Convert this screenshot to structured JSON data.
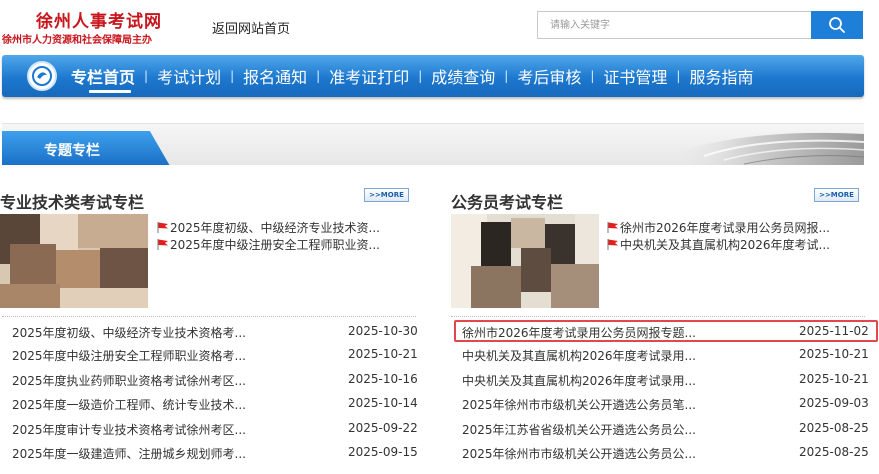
{
  "header": {
    "site_title": "徐州人事考试网",
    "site_subtitle": "徐州市人力资源和社会保障局主办",
    "home_link": "返回网站首页",
    "search_placeholder": "请输入关键字"
  },
  "nav": {
    "items": [
      "专栏首页",
      "考试计划",
      "报名通知",
      "准考证打印",
      "成绩查询",
      "考后审核",
      "证书管理",
      "服务指南"
    ],
    "active_index": 0
  },
  "banner": {
    "label": "专题专栏"
  },
  "colors": {
    "accent_blue": "#1e7fd8",
    "brand_red": "#c8161d",
    "flag_red": "#e02020",
    "highlight_red": "#e0484e"
  },
  "left": {
    "title": "专业技术类考试专栏",
    "more": ">>MORE",
    "featured": [
      "2025年度初级、中级经济专业技术资...",
      "2025年度中级注册安全工程师职业资..."
    ],
    "list": [
      {
        "title": "2025年度初级、中级经济专业技术资格考...",
        "date": "2025-10-30"
      },
      {
        "title": "2025年度中级注册安全工程师职业资格考...",
        "date": "2025-10-21"
      },
      {
        "title": "2025年度执业药师职业资格考试徐州考区...",
        "date": "2025-10-16"
      },
      {
        "title": "2025年度一级造价工程师、统计专业技术...",
        "date": "2025-10-14"
      },
      {
        "title": "2025年度审计专业技术资格考试徐州考区...",
        "date": "2025-09-22"
      },
      {
        "title": "2025年度一级建造师、注册城乡规划师考...",
        "date": "2025-09-15"
      }
    ]
  },
  "right": {
    "title": "公务员考试专栏",
    "more": ">>MORE",
    "featured": [
      "徐州市2026年度考试录用公务员网报...",
      "中央机关及其直属机构2026年度考试..."
    ],
    "list": [
      {
        "title": "徐州市2026年度考试录用公务员网报专题...",
        "date": "2025-11-02"
      },
      {
        "title": "中央机关及其直属机构2026年度考试录用...",
        "date": "2025-10-21"
      },
      {
        "title": "中央机关及其直属机构2026年度考试录用...",
        "date": "2025-10-21"
      },
      {
        "title": "2025年徐州市市级机关公开遴选公务员笔...",
        "date": "2025-09-03"
      },
      {
        "title": "2025年江苏省省级机关公开遴选公务员公...",
        "date": "2025-08-25"
      },
      {
        "title": "2025年徐州市市级机关公开遴选公务员公...",
        "date": "2025-08-25"
      }
    ]
  }
}
